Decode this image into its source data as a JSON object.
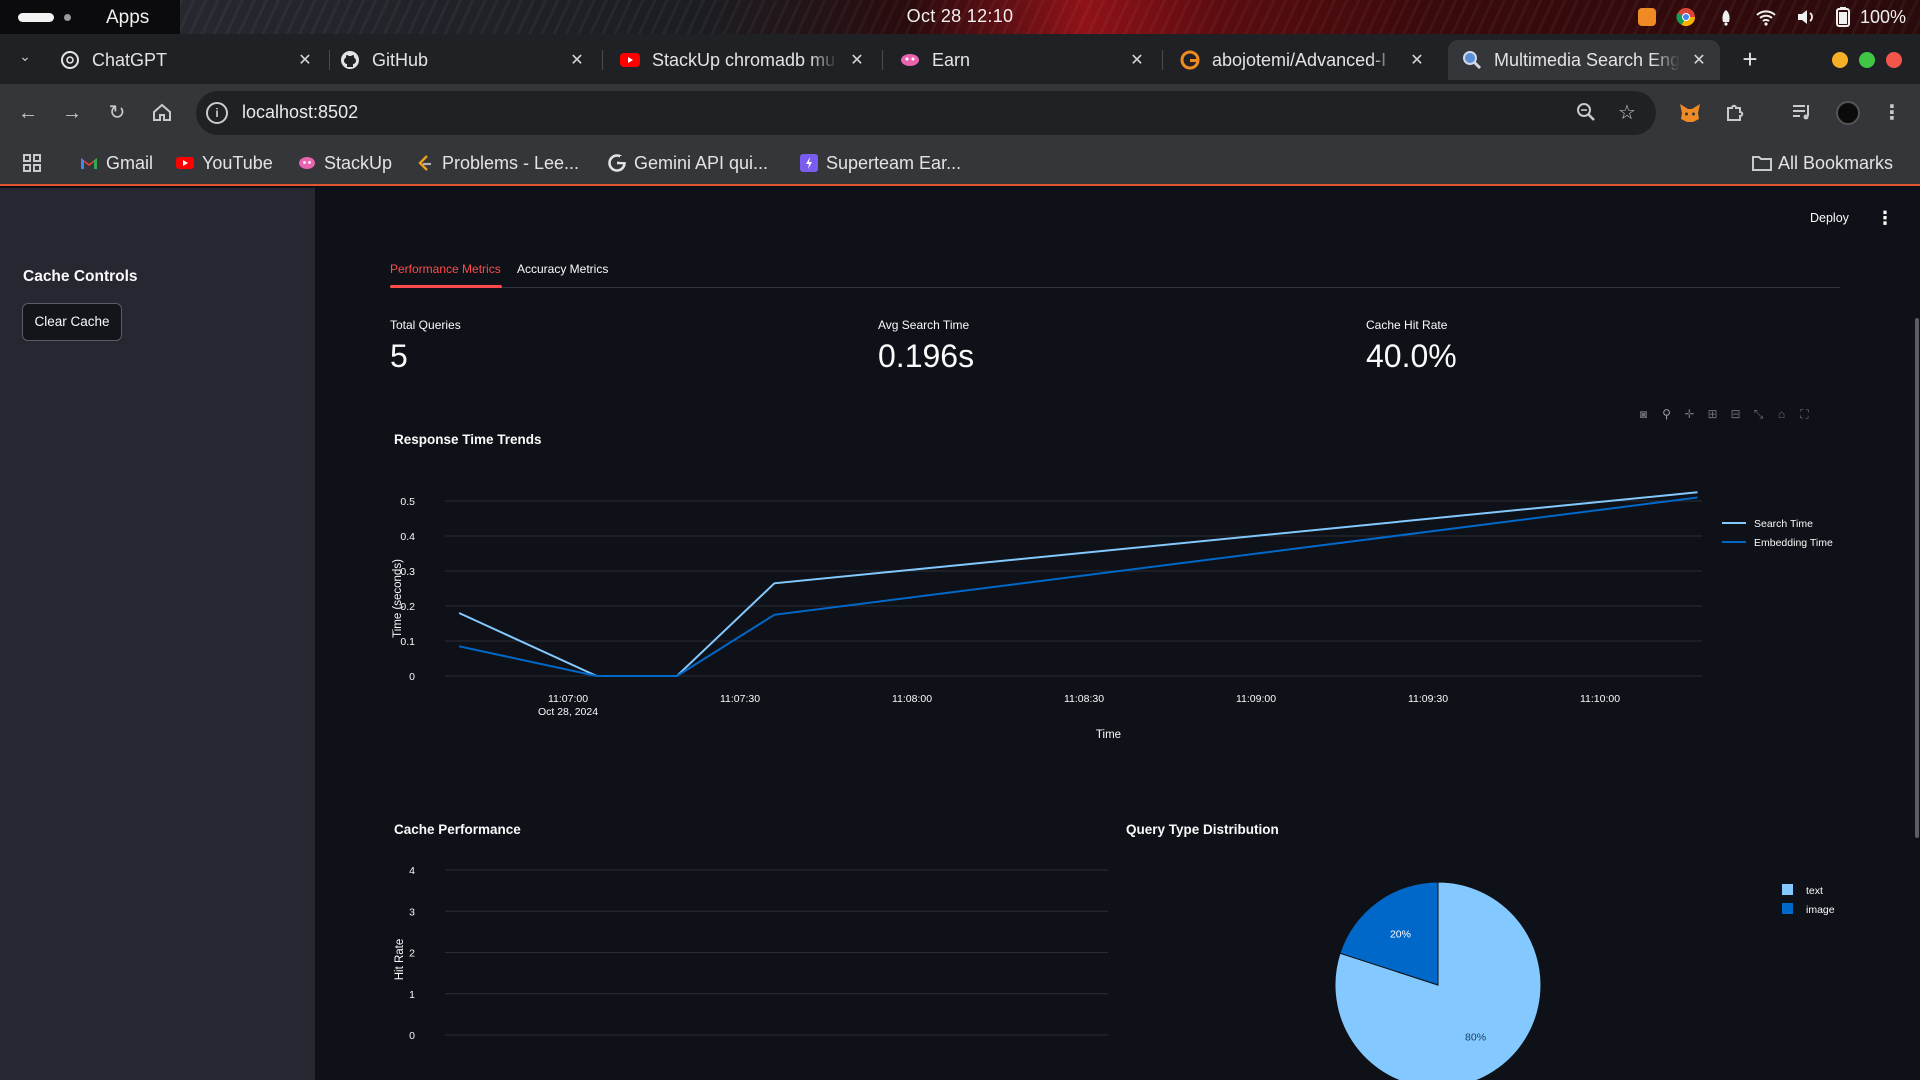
{
  "os": {
    "apps_label": "Apps",
    "clock": "Oct 28  12:10",
    "battery": "100%"
  },
  "browser": {
    "tabs": [
      {
        "label": "ChatGPT",
        "icon": "chatgpt-icon"
      },
      {
        "label": "GitHub",
        "icon": "github-icon"
      },
      {
        "label": "StackUp chromadb mu",
        "icon": "youtube-icon"
      },
      {
        "label": "Earn",
        "icon": "earn-icon"
      },
      {
        "label": "abojotemi/Advanced-I",
        "icon": "gitlab-like-icon"
      },
      {
        "label": "Multimedia Search Eng",
        "icon": "search-icon",
        "active": true
      }
    ],
    "url": "localhost:8502",
    "bookmarks": [
      {
        "label": "Gmail",
        "icon": "gmail-icon"
      },
      {
        "label": "YouTube",
        "icon": "youtube-icon"
      },
      {
        "label": "StackUp",
        "icon": "stackup-icon"
      },
      {
        "label": "Problems - Lee...",
        "icon": "leetcode-icon"
      },
      {
        "label": "Gemini API qui...",
        "icon": "google-icon"
      },
      {
        "label": "Superteam Ear...",
        "icon": "superteam-icon"
      }
    ],
    "all_bookmarks": "All Bookmarks"
  },
  "app": {
    "deploy_label": "Deploy",
    "sidebar": {
      "title": "Cache Controls",
      "clear_button": "Clear Cache"
    },
    "tabs": [
      {
        "label": "Performance Metrics",
        "active": true
      },
      {
        "label": "Accuracy Metrics",
        "active": false
      }
    ],
    "metrics": [
      {
        "label": "Total Queries",
        "value": "5"
      },
      {
        "label": "Avg Search Time",
        "value": "0.196s"
      },
      {
        "label": "Cache Hit Rate",
        "value": "40.0%"
      }
    ]
  },
  "colors": {
    "accent": "#ff4b4b",
    "series_light": "#83c9ff",
    "series_dark": "#0068c9",
    "sidebar_bg": "#262730",
    "main_bg": "#0e1117"
  },
  "chart_data": [
    {
      "type": "line",
      "title": "Response Time Trends",
      "xlabel": "Time",
      "ylabel": "Time (seconds)",
      "x_ticks": [
        "11:07:00",
        "11:07:30",
        "11:08:00",
        "11:08:30",
        "11:09:00",
        "11:09:30",
        "11:10:00"
      ],
      "x_tick_sublabel": "Oct 28, 2024",
      "ylim": [
        0,
        0.5
      ],
      "y_ticks": [
        "0",
        "0.1",
        "0.2",
        "0.3",
        "0.4",
        "0.5"
      ],
      "legend": "top-right",
      "series": [
        {
          "name": "Search Time",
          "color": "#83c9ff",
          "x": [
            "11:06:41",
            "11:07:05",
            "11:07:19",
            "11:07:36",
            "11:10:17"
          ],
          "y": [
            0.18,
            0,
            0,
            0.265,
            0.525
          ]
        },
        {
          "name": "Embedding Time",
          "color": "#0068c9",
          "x": [
            "11:06:41",
            "11:07:05",
            "11:07:19",
            "11:07:36",
            "11:10:17"
          ],
          "y": [
            0.085,
            0,
            0,
            0.175,
            0.51
          ]
        }
      ]
    },
    {
      "type": "line",
      "title": "Cache Performance",
      "ylabel": "Hit Rate",
      "y_ticks": [
        "4",
        "3",
        "2",
        "1",
        "0"
      ],
      "ylim": [
        0,
        4
      ]
    },
    {
      "type": "pie",
      "title": "Query Type Distribution",
      "legend": "top-right",
      "slices": [
        {
          "label": "text",
          "value": 80,
          "text": "80%",
          "color": "#83c9ff"
        },
        {
          "label": "image",
          "value": 20,
          "text": "20%",
          "color": "#0068c9"
        }
      ]
    }
  ]
}
